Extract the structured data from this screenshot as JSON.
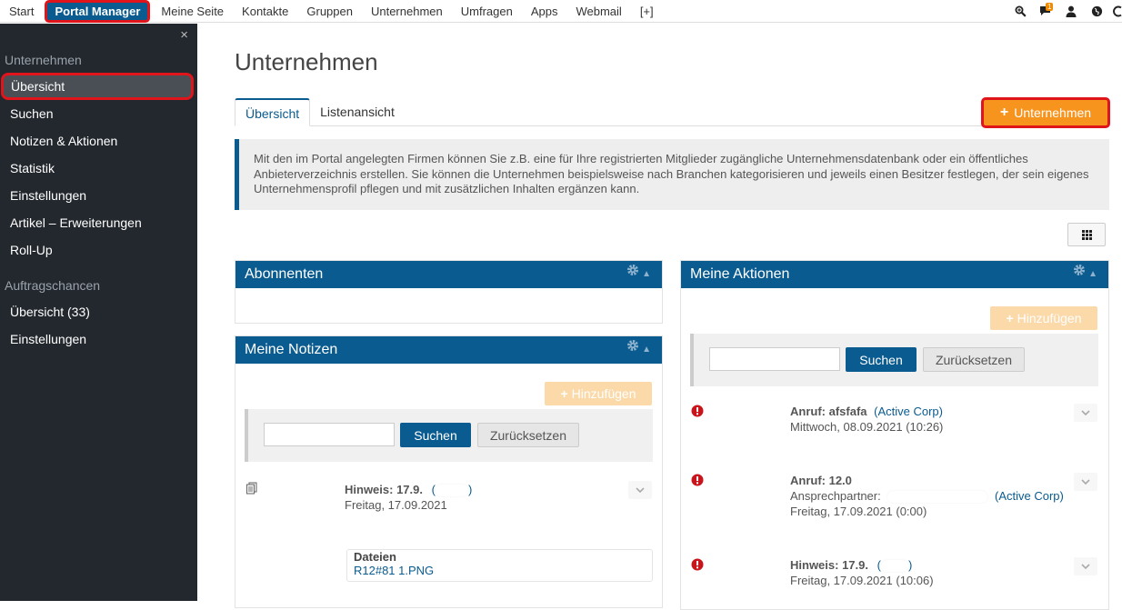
{
  "topnav": {
    "items": [
      "Start",
      "Portal Manager",
      "Meine Seite",
      "Kontakte",
      "Gruppen",
      "Unternehmen",
      "Umfragen",
      "Apps",
      "Webmail",
      "[+]"
    ],
    "active_index": 1,
    "notification_count": "1"
  },
  "sidebar": {
    "close": "×",
    "section1": "Unternehmen",
    "items1": [
      "Übersicht",
      "Suchen",
      "Notizen & Aktionen",
      "Statistik",
      "Einstellungen",
      "Artikel – Erweiterungen",
      "Roll-Up"
    ],
    "section2": "Auftragschancen",
    "items2": [
      "Übersicht (33)",
      "Einstellungen"
    ]
  },
  "main": {
    "title": "Unternehmen",
    "tabs": [
      "Übersicht",
      "Listenansicht"
    ],
    "add_company_label": "Unternehmen",
    "info": "Mit den im Portal angelegten Firmen können Sie z.B. eine für Ihre registrierten Mitglieder zugängliche Unternehmensdatenbank oder ein öffentliches Anbieterverzeichnis erstellen. Sie können die Unternehmen beispielsweise nach Branchen kategorisieren und jeweils einen Besitzer festlegen, der sein eigenes Unternehmensprofil pflegen und mit zusätzlichen Inhalten ergänzen kann."
  },
  "panels": {
    "subscribers": {
      "title": "Abonnenten"
    },
    "notes": {
      "title": "Meine Notizen",
      "add_label": "Hinzufügen",
      "search_label": "Suchen",
      "reset_label": "Zurücksetzen",
      "entry": {
        "title": "Hinweis: 17.9.",
        "paren_open": "(",
        "paren_close": ")",
        "date": "Freitag, 17.09.2021",
        "files_label": "Dateien",
        "file_name": "R12#81 1.PNG"
      }
    },
    "actions": {
      "title": "Meine Aktionen",
      "add_label": "Hinzufügen",
      "search_label": "Suchen",
      "reset_label": "Zurücksetzen",
      "entries": [
        {
          "title": "Anruf: afsfafa",
          "link": "(Active Corp)",
          "line2": "",
          "date": "Mittwoch, 08.09.2021 (10:26)"
        },
        {
          "title": "Anruf: 12.0",
          "link": "(Active Corp)",
          "line2": "Ansprechpartner:",
          "date": "Freitag, 17.09.2021 (0:00)"
        },
        {
          "title": "Hinweis: 17.9.",
          "link": "",
          "line2": "",
          "date": "Freitag, 17.09.2021 (10:06)",
          "paren_open": "(",
          "paren_close": ")"
        }
      ]
    }
  },
  "colors": {
    "brand": "#0a5b8f",
    "accent": "#f7941e",
    "sidebar": "#23282e",
    "highlight": "#e0141b",
    "alert": "#c9141b"
  }
}
